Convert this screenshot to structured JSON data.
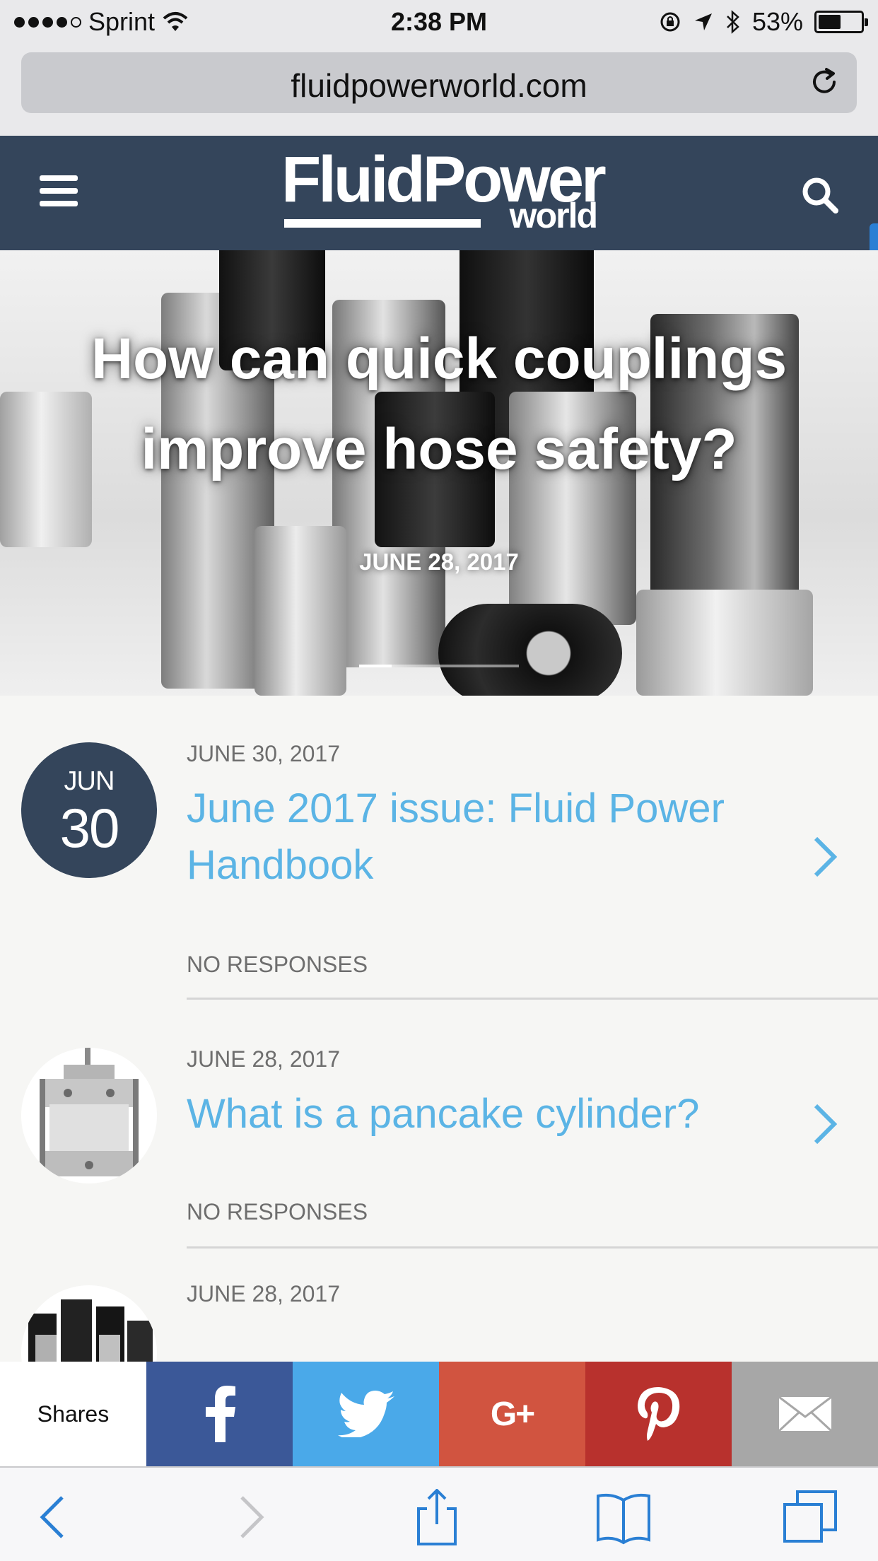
{
  "status_bar": {
    "carrier": "Sprint",
    "time": "2:38 PM",
    "battery": "53%",
    "battery_level": 0.53
  },
  "browser": {
    "url": "fluidpowerworld.com"
  },
  "site": {
    "logo_line1": "FluidPower",
    "logo_line2": "world"
  },
  "hero": {
    "title": "How can quick couplings improve hose safety?",
    "date": "JUNE 28, 2017"
  },
  "articles": [
    {
      "badge_month": "JUN",
      "badge_day": "30",
      "date": "JUNE 30, 2017",
      "title": "June 2017 issue: Fluid Power Handbook",
      "responses": "NO RESPONSES"
    },
    {
      "date": "JUNE 28, 2017",
      "title": "What is a pancake cylinder?",
      "responses": "NO RESPONSES"
    },
    {
      "date": "JUNE 28, 2017"
    }
  ],
  "share_bar": {
    "label": "Shares",
    "buttons": [
      "facebook-icon",
      "twitter-icon",
      "google-plus-icon",
      "pinterest-icon",
      "email-icon"
    ],
    "colors": {
      "facebook": "#3b5898",
      "twitter": "#4aa9e9",
      "google_plus": "#d15440",
      "pinterest": "#b8312d",
      "email": "#a7a7a7"
    },
    "gplus_glyph": "G+"
  },
  "colors": {
    "header_bg": "#34455b",
    "link": "#5bb4e5",
    "ios_blue": "#2a7fd4"
  }
}
